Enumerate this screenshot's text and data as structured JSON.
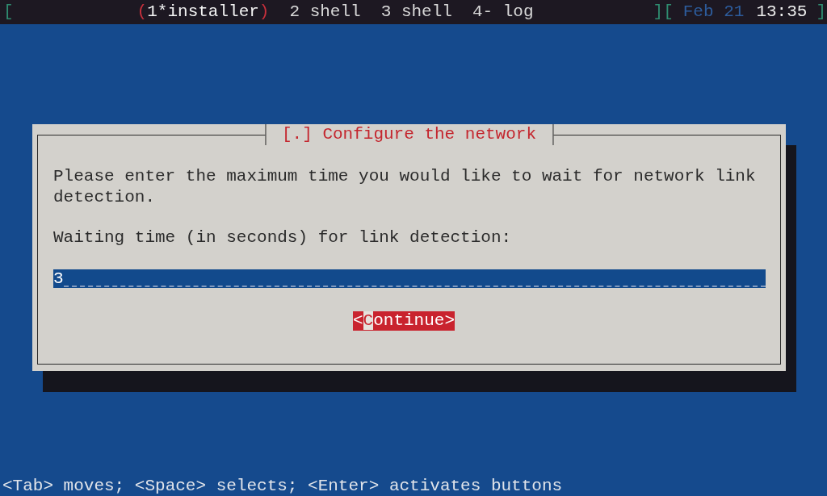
{
  "status_bar": {
    "left_bracket": "[",
    "windows": [
      {
        "label": "1*installer",
        "selected": true,
        "open_mark": "(",
        "close_mark": ")"
      },
      {
        "label": "2 shell",
        "selected": false
      },
      {
        "label": "3 shell",
        "selected": false
      },
      {
        "label": "4- log",
        "selected": false
      }
    ],
    "separator": "][",
    "date": "Feb 21",
    "time": "13:35",
    "right_bracket": "]"
  },
  "dialog": {
    "title": "[.] Configure the network",
    "message": "Please enter the maximum time you would like to wait for network link detection.",
    "field_label": "Waiting time (in seconds) for link detection:",
    "field": {
      "value": "3"
    },
    "button": {
      "label_parts": [
        {
          "text": "<",
          "cursor": false
        },
        {
          "text": "C",
          "cursor": true
        },
        {
          "text": "ontinue>",
          "cursor": false
        }
      ]
    }
  },
  "help_line": "<Tab> moves; <Space> selects; <Enter> activates buttons"
}
